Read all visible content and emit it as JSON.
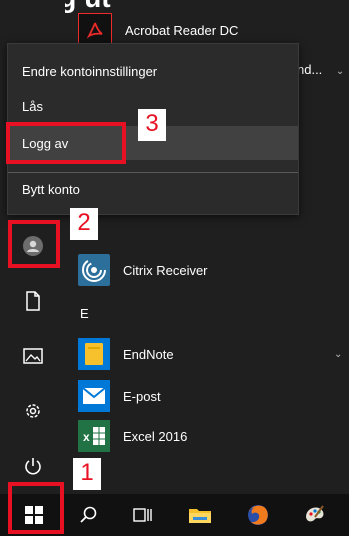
{
  "header_caption": "Logg ut",
  "apps": {
    "acrobat": {
      "label": "Acrobat Reader DC",
      "icon": "adobe-acrobat-icon"
    },
    "truncated": {
      "label": "nd...",
      "icon": "chevron-down-icon"
    },
    "citrix": {
      "label": "Citrix Receiver",
      "icon": "citrix-icon"
    },
    "section_letter": "E",
    "endnote": {
      "label": "EndNote",
      "icon": "folder-icon"
    },
    "epost": {
      "label": "E-post",
      "icon": "mail-icon"
    },
    "excel": {
      "label": "Excel 2016",
      "icon": "excel-icon"
    }
  },
  "account_menu": {
    "items": [
      {
        "label": "Endre kontoinnstillinger"
      },
      {
        "label": "Lås"
      },
      {
        "label": "Logg av"
      },
      {
        "label": "Bytt konto"
      }
    ]
  },
  "annotations": {
    "step1": "1",
    "step2": "2",
    "step3": "3"
  },
  "taskbar": {
    "icons": [
      "windows-icon",
      "search-icon",
      "task-view-icon",
      "file-explorer-icon",
      "firefox-icon",
      "paint-icon"
    ]
  },
  "colors": {
    "annotation_red": "#e81123",
    "menu_bg": "#2b2b2b",
    "excel_green": "#217346",
    "mail_blue": "#0078d7",
    "endnote_yellow": "#f6c12c"
  }
}
